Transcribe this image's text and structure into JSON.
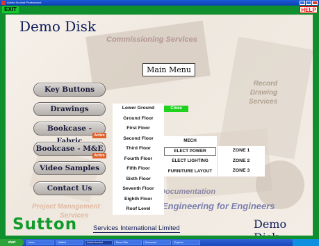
{
  "window": {
    "title": "Adobe Acrobat Professional"
  },
  "toolbar": {
    "exit_label": "EXIT",
    "help_label": "HELP"
  },
  "header": {
    "demo_top": "Demo Disk",
    "main_menu": "Main Menu"
  },
  "background_text": {
    "commissioning": "Commissioning Services",
    "record_1": "Record",
    "record_2": "Drawing",
    "record_3": "Services",
    "documentation": "Documentation",
    "engineering": "Engineering for Engineers",
    "pm_1": "Project Management",
    "pm_2": "Services"
  },
  "sidebar": {
    "items": [
      {
        "label": "Key Buttons"
      },
      {
        "label": "Drawings"
      },
      {
        "label": "Bookcase - Fabric"
      },
      {
        "label": "Bookcase - M&E"
      },
      {
        "label": "Video Samples"
      },
      {
        "label": "Contact Us"
      }
    ],
    "active_label": "Active"
  },
  "floor_menu": {
    "items": [
      "Lower Ground",
      "Ground Floor",
      "First Floor",
      "Second Floor",
      "Third Floor",
      "Fourth Floor",
      "Fifth Floor",
      "Sixth Floor",
      "Seventh Floor",
      "Eighth Floor",
      "Roof Level"
    ]
  },
  "close_label": "Close",
  "mech_menu": {
    "items": [
      "MECH",
      "ELECT POWER",
      "ELECT LIGHTING",
      "FURNITURE LAYOUT"
    ]
  },
  "zone_menu": {
    "items": [
      "ZONE 1",
      "ZONE 2",
      "ZONE 3"
    ]
  },
  "footer": {
    "brand": "Sutton",
    "services": "Services International Limited",
    "demo_bottom": "Demo Disk"
  },
  "taskbar": {
    "start_label": "start",
    "items": [
      "Inbox",
      "Untitled",
      "Adobe Acrobat",
      "Demo Disk",
      "Document",
      "Explorer"
    ]
  }
}
